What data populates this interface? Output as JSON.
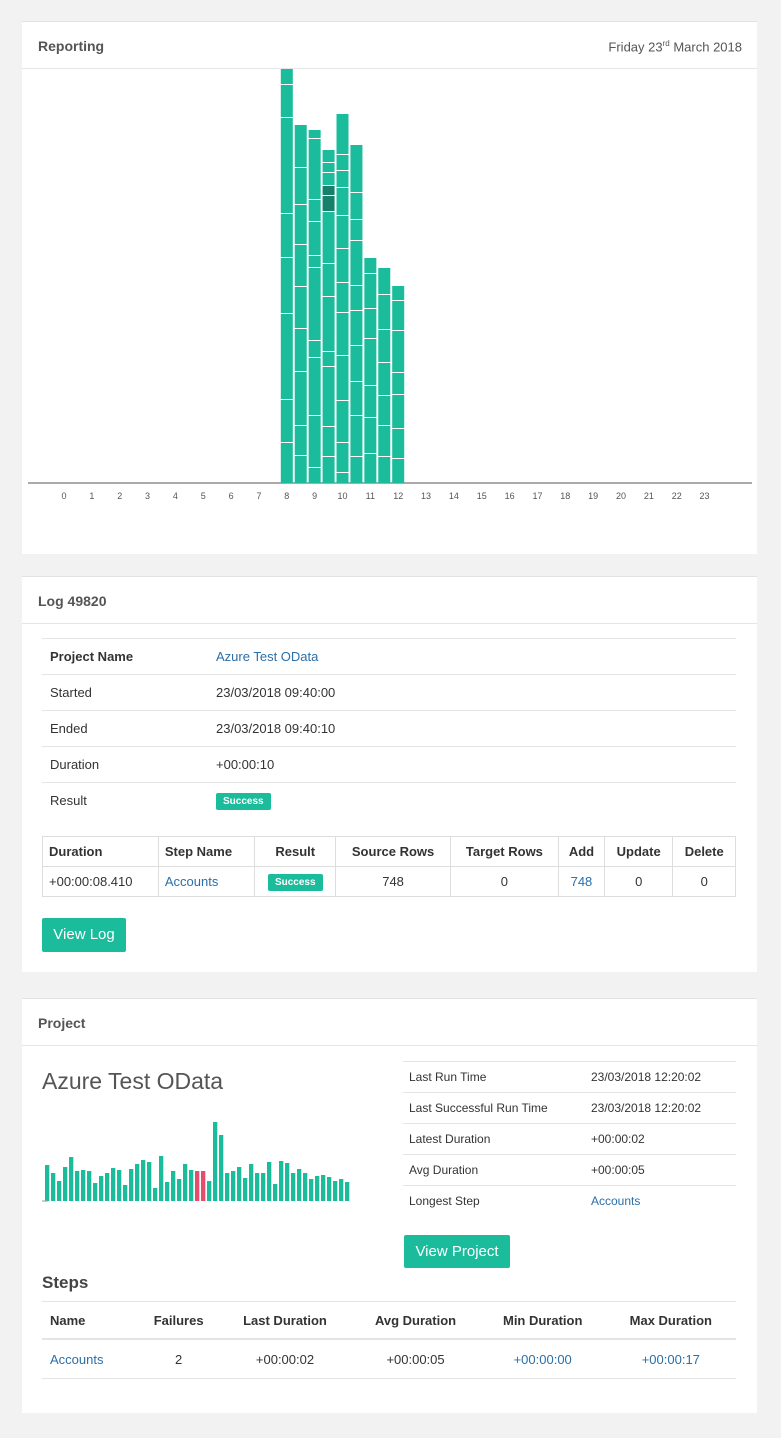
{
  "reporting": {
    "title": "Reporting",
    "date_prefix": "Friday 23",
    "date_sup": "rd",
    "date_suffix": " March 2018",
    "colors": {
      "bar": "#1abc9c",
      "bar_selected": "#16806a",
      "axis": "#555555"
    },
    "chart_data": {
      "type": "bar",
      "categories": [
        "0",
        "1",
        "2",
        "3",
        "4",
        "5",
        "6",
        "7",
        "8",
        "9",
        "10",
        "11",
        "12",
        "13",
        "14",
        "15",
        "16",
        "17",
        "18",
        "19",
        "20",
        "21",
        "22",
        "23"
      ],
      "stacked_runs": [
        {
          "hour": 8,
          "segments": [
            41,
            43,
            86,
            56,
            44,
            96,
            33,
            55
          ]
        },
        {
          "hour": 8.5,
          "segments": [
            28,
            30,
            54,
            43,
            42,
            42,
            40,
            37,
            43
          ]
        },
        {
          "hour": 9,
          "segments": [
            16,
            52,
            58,
            17,
            73,
            12,
            34,
            22,
            61,
            9
          ]
        },
        {
          "hour": 9.5,
          "segments": [
            27,
            30,
            60,
            15,
            55,
            33,
            52,
            16,
            10,
            13,
            10,
            13
          ]
        },
        {
          "hour": 10,
          "segments": [
            11,
            30,
            42,
            45,
            43,
            30,
            34,
            33,
            28,
            17,
            16,
            41
          ]
        },
        {
          "hour": 10.5,
          "segments": [
            27,
            41,
            34,
            36,
            35,
            25,
            45,
            21,
            27,
            48
          ]
        },
        {
          "hour": 11,
          "segments": [
            30,
            36,
            32,
            47,
            30,
            35,
            16
          ]
        },
        {
          "hour": 11.5,
          "segments": [
            27,
            31,
            30,
            33,
            33,
            35,
            27
          ]
        },
        {
          "hour": 12,
          "segments": [
            25,
            30,
            34,
            22,
            42,
            30,
            15
          ]
        }
      ],
      "ylim": [
        0,
        400
      ]
    }
  },
  "log": {
    "title": "Log 49820",
    "details": [
      {
        "key": "Project Name",
        "value": "Azure Test OData",
        "link": true,
        "bold": true
      },
      {
        "key": "Started",
        "value": "23/03/2018 09:40:00"
      },
      {
        "key": "Ended",
        "value": "23/03/2018 09:40:10"
      },
      {
        "key": "Duration",
        "value": "+00:00:10"
      },
      {
        "key": "Result",
        "value": "Success",
        "badge": true
      }
    ],
    "steps_headers": [
      "Duration",
      "Step Name",
      "Result",
      "Source Rows",
      "Target Rows",
      "Add",
      "Update",
      "Delete"
    ],
    "steps_rows": [
      {
        "duration": "+00:00:08.410",
        "step_name": "Accounts",
        "result": "Success",
        "source_rows": "748",
        "target_rows": "0",
        "add": "748",
        "update": "0",
        "delete": "0"
      }
    ],
    "view_log_label": "View Log"
  },
  "project": {
    "title": "Project",
    "name": "Azure Test OData",
    "info": [
      {
        "key": "Last Run Time",
        "value": "23/03/2018 12:20:02"
      },
      {
        "key": "Last Successful Run Time",
        "value": "23/03/2018 12:20:02"
      },
      {
        "key": "Latest Duration",
        "value": "+00:00:02"
      },
      {
        "key": "Avg Duration",
        "value": "+00:00:05"
      },
      {
        "key": "Longest Step",
        "value": "Accounts",
        "link": true
      }
    ],
    "view_project_label": "View Project",
    "spark_colors": {
      "ok": "#1abc9c",
      "fail": "#e74c6c"
    },
    "spark_data": {
      "type": "bar",
      "values": [
        36,
        28,
        20,
        34,
        44,
        30,
        31,
        30,
        18,
        25,
        28,
        33,
        31,
        16,
        32,
        37,
        41,
        39,
        13,
        45,
        19,
        30,
        22,
        37,
        31,
        30,
        30,
        20,
        79,
        66,
        28,
        30,
        34,
        23,
        37,
        28,
        28,
        39,
        17,
        40,
        38,
        28,
        32,
        28,
        22,
        25,
        26,
        24,
        20,
        22,
        19
      ],
      "failed_indices": [
        25,
        26
      ]
    },
    "steps_heading": "Steps",
    "summary_headers": [
      "Name",
      "Failures",
      "Last Duration",
      "Avg Duration",
      "Min Duration",
      "Max Duration"
    ],
    "summary_rows": [
      {
        "name": "Accounts",
        "failures": "2",
        "last": "+00:00:02",
        "avg": "+00:00:05",
        "min": "+00:00:00",
        "max": "+00:00:17"
      }
    ]
  }
}
